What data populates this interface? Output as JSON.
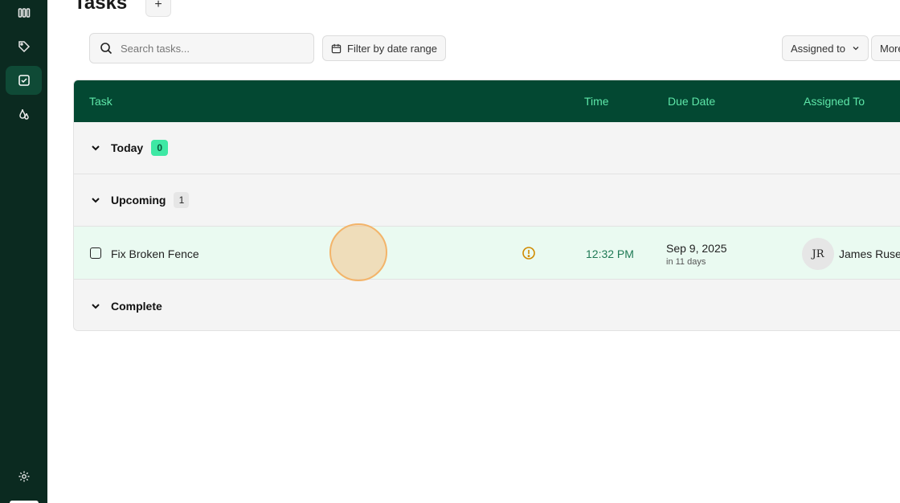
{
  "colors": {
    "sidebar_bg": "#0b2a20",
    "header_bg": "#034832",
    "header_text": "#5ee6a8",
    "accent_badge": "#3ee8a4",
    "task_row_bg": "#eafaf1",
    "warning": "#d08a00"
  },
  "sidebar": {
    "items": [
      {
        "icon": "board-icon"
      },
      {
        "icon": "tag-icon"
      },
      {
        "icon": "tasks-icon",
        "active": true
      },
      {
        "icon": "drop-icon"
      }
    ],
    "footer_icon": "gear-icon"
  },
  "header": {
    "title": "Tasks",
    "add_label": "+"
  },
  "toolbar": {
    "search_placeholder": "Search tasks...",
    "filter_label": "Filter by date range",
    "assigned_label": "Assigned to",
    "more_label": "More"
  },
  "table": {
    "columns": {
      "task": "Task",
      "time": "Time",
      "due_date": "Due Date",
      "assigned_to": "Assigned To"
    },
    "groups": [
      {
        "label": "Today",
        "count": "0"
      },
      {
        "label": "Upcoming",
        "count": "1"
      },
      {
        "label": "Complete"
      }
    ],
    "task": {
      "name": "Fix Broken Fence",
      "time": "12:32 PM",
      "due_date": "Sep 9, 2025",
      "due_relative": "in 11 days",
      "assignee_initials": "JR",
      "assignee_name": "James Ruse"
    }
  }
}
